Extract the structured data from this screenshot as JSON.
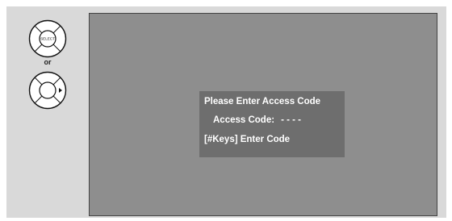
{
  "remote": {
    "select_label": "SELECT",
    "or_label": "or",
    "select_button_icon": "dpad-select-icon",
    "right_button_icon": "dpad-right-arrow-icon"
  },
  "dialog": {
    "title": "Please Enter Access Code",
    "code_label": "Access Code:",
    "code_value": "- - - -",
    "help_text": "[#Keys] Enter Code"
  },
  "colors": {
    "panel_background": "#d9d9d9",
    "screen_background": "#8e8e8e",
    "dialog_background": "#6e6e6e",
    "dialog_text": "#ffffff"
  }
}
